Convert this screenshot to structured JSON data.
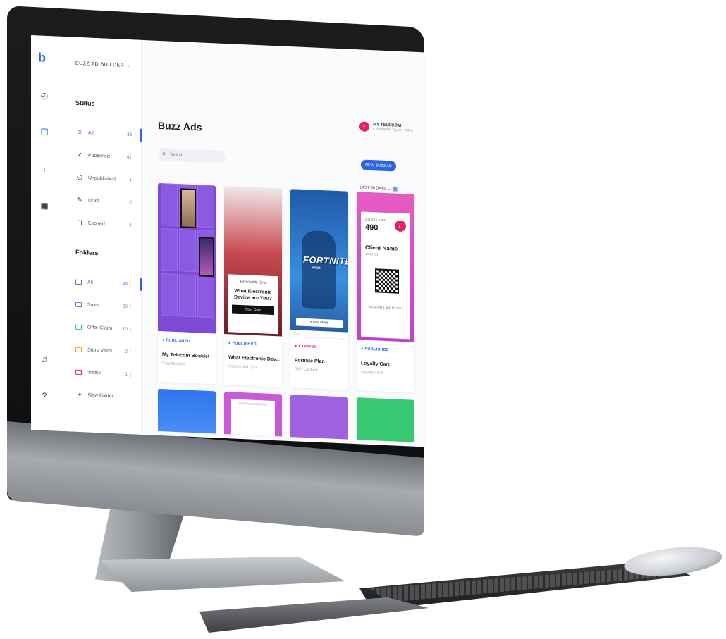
{
  "app": {
    "name": "BUZZ AD BUILDER"
  },
  "rail": {
    "items": [
      "dashboard-icon",
      "ads-icon",
      "analytics-icon",
      "contacts-icon",
      "notifications-icon",
      "help-icon"
    ]
  },
  "status": {
    "heading": "Status",
    "items": [
      {
        "label": "All",
        "count": "45",
        "active": true
      },
      {
        "label": "Published",
        "count": "41"
      },
      {
        "label": "Unpublished",
        "count": "1"
      },
      {
        "label": "Draft",
        "count": "2"
      },
      {
        "label": "Expired",
        "count": "1"
      }
    ]
  },
  "folders": {
    "heading": "Folders",
    "items": [
      {
        "label": "All",
        "count": "43",
        "color": "#6e6e6e",
        "active": true
      },
      {
        "label": "Sales",
        "count": "30",
        "color": "#b352d6"
      },
      {
        "label": "Offer Claim",
        "count": "10",
        "color": "#36c26a"
      },
      {
        "label": "Store Visits",
        "count": "2",
        "color": "#f2a03a"
      },
      {
        "label": "Traffic",
        "count": "1",
        "color": "#e8215e"
      }
    ],
    "new_folder": "New Folder"
  },
  "header": {
    "title": "Buzz Ads",
    "account_name": "MY TELECOM",
    "account_user": "Christopher Taylor · Admin"
  },
  "toolbar": {
    "search_placeholder": "Search...",
    "new_button": "NEW BUZZ AD",
    "filter": "LAST 30 DAYS"
  },
  "cards": [
    {
      "status": "PUBLISHED",
      "status_color": "#2f63e6",
      "name": "My Telecom Booklet",
      "type": "Card Booklet"
    },
    {
      "status": "PUBLISHED",
      "status_color": "#2f63e6",
      "name": "What Electronic Dev...",
      "type": "Segmented Quiz",
      "quiz_kicker": "Personality Quiz",
      "quiz_title": "What Electronic Device are You?",
      "quiz_button": "Start Quiz"
    },
    {
      "status": "EXPIRED",
      "status_color": "#e8215e",
      "name": "Fortnite Plan",
      "type": "Rich Card Ad",
      "banner_title": "FORTNITE",
      "banner_sub": "Plan",
      "banner_button": "Know More"
    },
    {
      "status": "PUBLISHED",
      "status_color": "#2f63e6",
      "name": "Loyalty Card",
      "type": "Loyalty Card",
      "loyalty_tag": "LOYALTY CARD",
      "loyalty_points": "490",
      "loyalty_client": "Client Name",
      "loyalty_id": "18091420",
      "loyalty_valid": "VALID UNTIL JAN 12, 2021"
    }
  ],
  "row2": {
    "coupon_label": "DISCOUNT COUPON"
  }
}
